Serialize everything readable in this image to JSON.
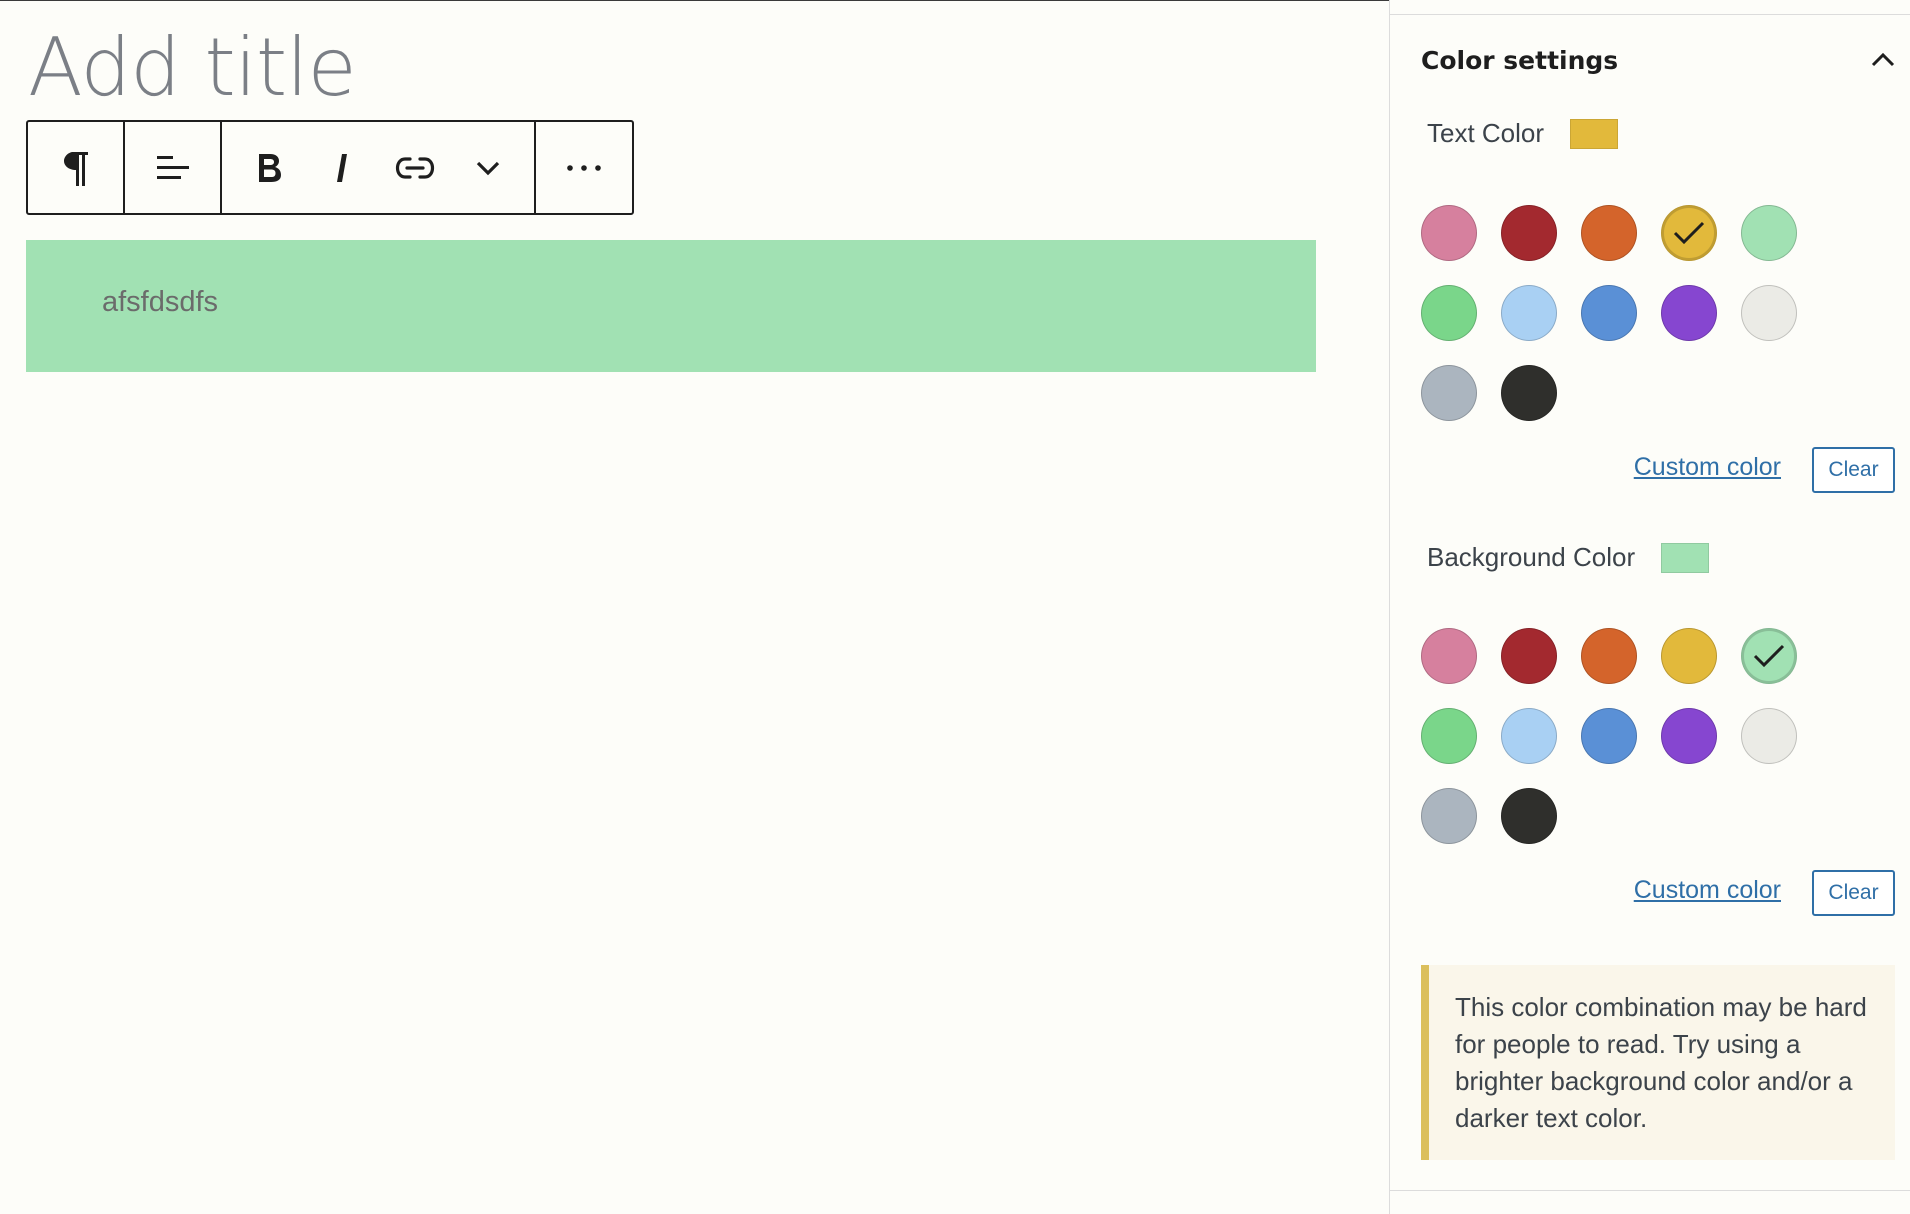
{
  "editor": {
    "title_placeholder": "Add title",
    "paragraph_text": "afsfdsdfs",
    "paragraph_background": "#a1e1b3",
    "toolbar": {
      "paragraph_icon": "pilcrow-icon",
      "align_icon": "align-left-icon",
      "bold_icon": "bold-icon",
      "italic_icon": "italic-icon",
      "link_icon": "link-icon",
      "more_formats_icon": "chevron-down-icon",
      "options_icon": "ellipsis-icon"
    }
  },
  "sidebar": {
    "panel_title": "Color settings",
    "collapse_icon": "chevron-up-icon",
    "text_color": {
      "label": "Text Color",
      "selected": "#e2b93b",
      "selected_index": 3,
      "custom_label": "Custom color",
      "clear_label": "Clear"
    },
    "background_color": {
      "label": "Background Color",
      "selected": "#a1e1b3",
      "selected_index": 4,
      "custom_label": "Custom color",
      "clear_label": "Clear"
    },
    "palette": [
      "#d6809e",
      "#a3292f",
      "#d4642b",
      "#e2b93b",
      "#a1e1b3",
      "#7ad68a",
      "#a9d0f3",
      "#5a90d6",
      "#8646d0",
      "#ebebe6",
      "#abb5bf",
      "#2f2f2c"
    ],
    "notice": "This color combination may be hard for people to read. Try using a brighter background color and/or a darker text color."
  }
}
